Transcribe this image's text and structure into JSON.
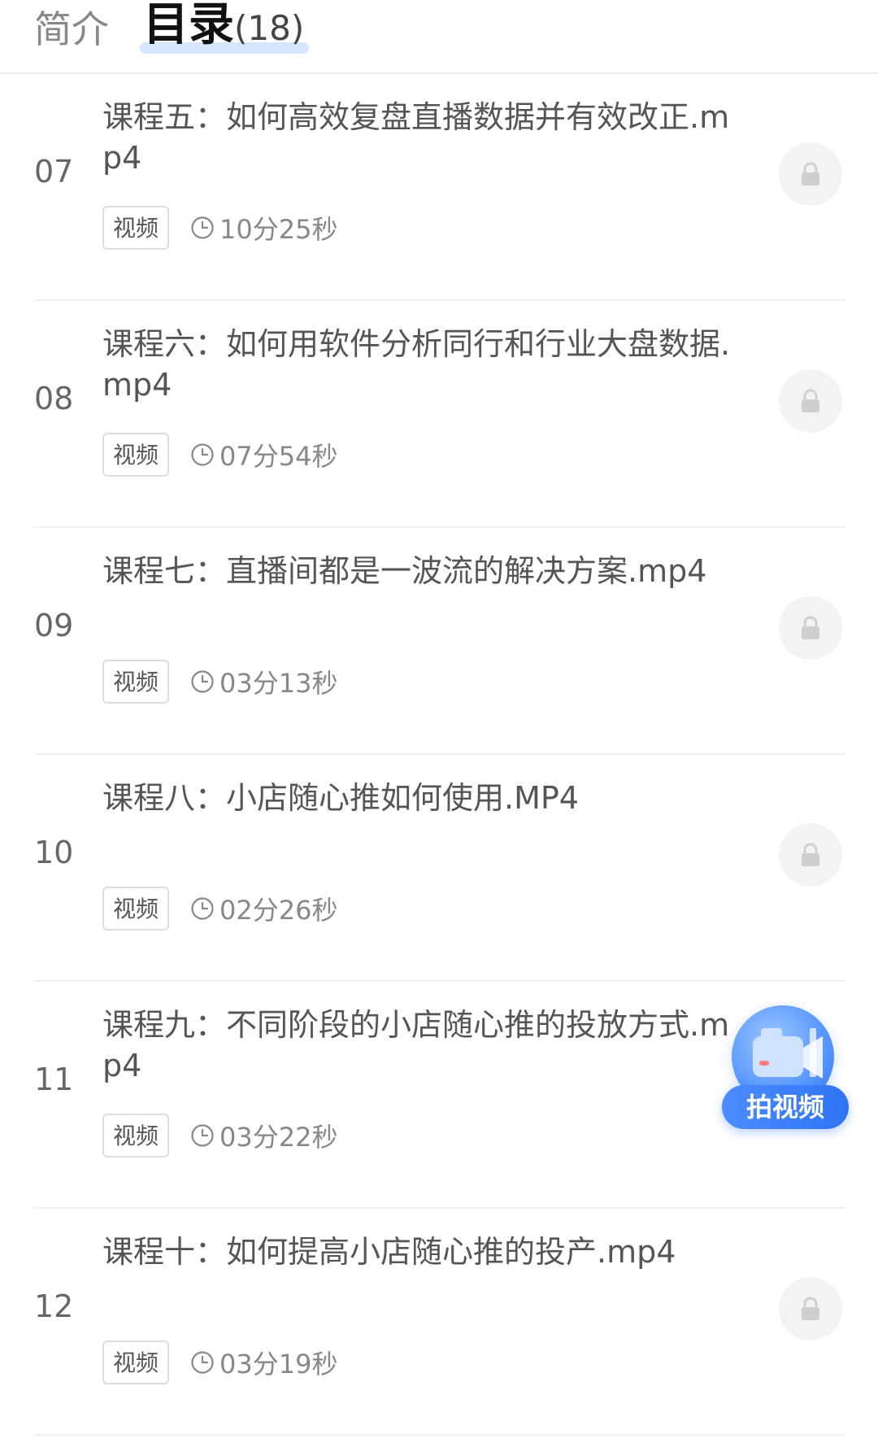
{
  "tabs": {
    "intro_label": "简介",
    "catalog_label": "目录",
    "catalog_count": "(18)"
  },
  "lessons": [
    {
      "index": "07",
      "title": "课程五：如何高效复盘直播数据并有效改正.mp4",
      "tag": "视频",
      "duration": "10分25秒"
    },
    {
      "index": "08",
      "title": "课程六：如何用软件分析同行和行业大盘数据.mp4",
      "tag": "视频",
      "duration": "07分54秒"
    },
    {
      "index": "09",
      "title": "课程七：直播间都是一波流的解决方案.mp4",
      "tag": "视频",
      "duration": "03分13秒"
    },
    {
      "index": "10",
      "title": "课程八：小店随心推如何使用.MP4",
      "tag": "视频",
      "duration": "02分26秒"
    },
    {
      "index": "11",
      "title": "课程九：不同阶段的小店随心推的投放方式.mp4",
      "tag": "视频",
      "duration": "03分22秒"
    },
    {
      "index": "12",
      "title": "课程十：如何提高小店随心推的投产.mp4",
      "tag": "视频",
      "duration": "03分19秒"
    }
  ],
  "fab": {
    "label": "拍视频"
  },
  "icons": {
    "lock": "lock-icon",
    "clock": "clock-icon",
    "camera": "camera-icon"
  },
  "colors": {
    "accent": "#2f74f5",
    "tab_underline": "#d7e6ff"
  }
}
